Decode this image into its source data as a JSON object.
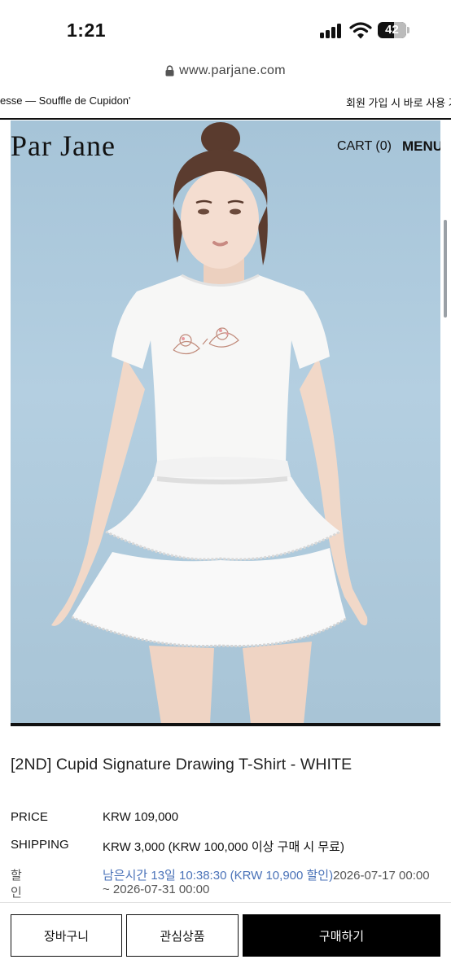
{
  "status_bar": {
    "time": "1:21",
    "battery": "42"
  },
  "browser": {
    "url": "www.parjane.com"
  },
  "marquee": {
    "left_text": "esse — Souffle de Cupidon'",
    "right_text": "회원 가입 시 바로 사용 가"
  },
  "header": {
    "logo": "Par Jane",
    "cart": "CART (0)",
    "menu": "MENU"
  },
  "product": {
    "title": "[2ND] Cupid Signature Drawing T-Shirt - WHITE",
    "price_label": "PRICE",
    "price_value": "KRW 109,000",
    "shipping_label": "SHIPPING",
    "shipping_value": "KRW 3,000 (KRW 100,000 이상 구매 시 무료)",
    "discount_label": "할인 기간",
    "discount_highlight": "남은시간 13일 10:38:30 (KRW 10,900 할인)",
    "discount_start": "2026-07-17 00:00",
    "discount_end": "~ 2026-07-31 00:00"
  },
  "actions": {
    "cart_button": "장바구니",
    "wishlist_button": "관심상품",
    "buy_button": "구매하기"
  },
  "colors": {
    "hero_background": "#a8c4d8",
    "discount_blue": "#4a72b8",
    "buy_button": "#000000"
  }
}
